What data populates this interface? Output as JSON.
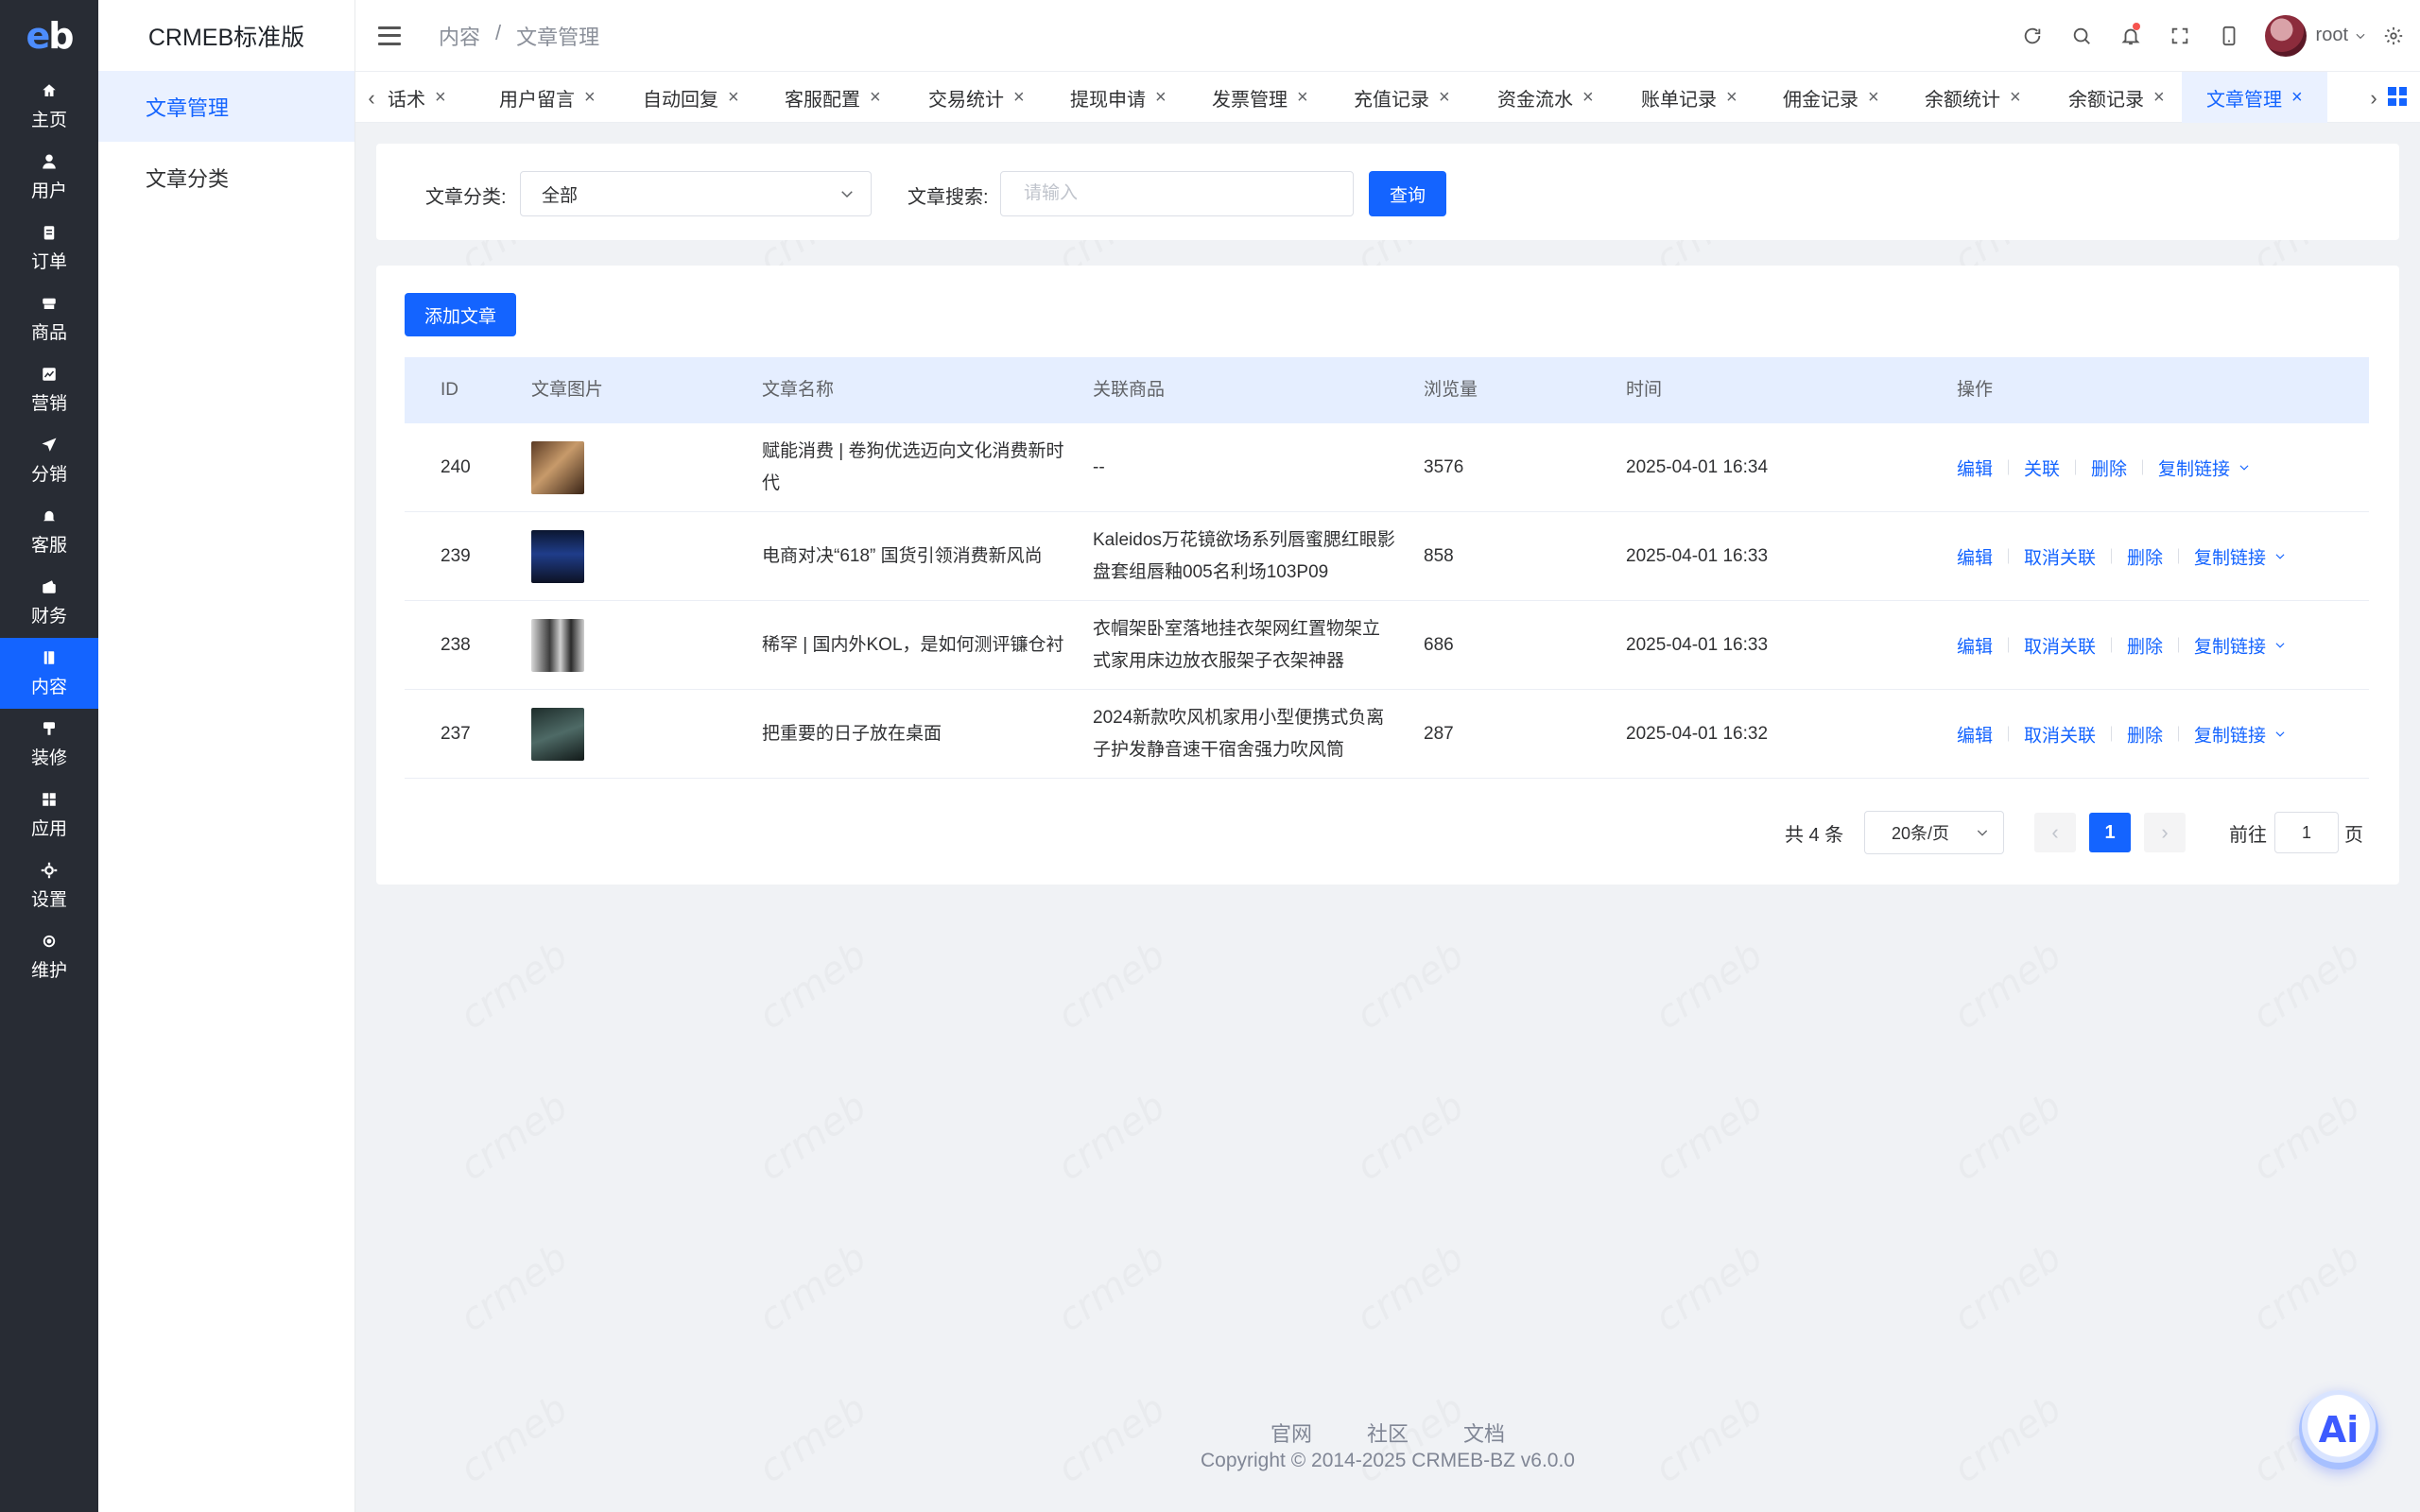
{
  "brand": {
    "logo_text": "eb",
    "title": "CRMEB标准版"
  },
  "rail": [
    {
      "label": "主页",
      "icon": "home-icon"
    },
    {
      "label": "用户",
      "icon": "user-icon"
    },
    {
      "label": "订单",
      "icon": "clipboard-icon"
    },
    {
      "label": "商品",
      "icon": "goods-icon"
    },
    {
      "label": "营销",
      "icon": "chart-icon"
    },
    {
      "label": "分销",
      "icon": "send-icon"
    },
    {
      "label": "客服",
      "icon": "bell-icon"
    },
    {
      "label": "财务",
      "icon": "wallet-icon"
    },
    {
      "label": "内容",
      "icon": "book-icon"
    },
    {
      "label": "装修",
      "icon": "brush-icon"
    },
    {
      "label": "应用",
      "icon": "apps-icon"
    },
    {
      "label": "设置",
      "icon": "gear-icon"
    },
    {
      "label": "维护",
      "icon": "chip-icon"
    }
  ],
  "rail_active": "内容",
  "submenu": [
    {
      "label": "文章管理"
    },
    {
      "label": "文章分类"
    }
  ],
  "breadcrumb": {
    "parent": "内容",
    "sep": "/",
    "current": "文章管理"
  },
  "user": {
    "name": "root"
  },
  "tabs": [
    {
      "label": "话术"
    },
    {
      "label": "用户留言"
    },
    {
      "label": "自动回复"
    },
    {
      "label": "客服配置"
    },
    {
      "label": "交易统计"
    },
    {
      "label": "提现申请"
    },
    {
      "label": "发票管理"
    },
    {
      "label": "充值记录"
    },
    {
      "label": "资金流水"
    },
    {
      "label": "账单记录"
    },
    {
      "label": "佣金记录"
    },
    {
      "label": "余额统计"
    },
    {
      "label": "余额记录"
    },
    {
      "label": "文章管理"
    }
  ],
  "filter": {
    "category_label": "文章分类:",
    "category_value": "全部",
    "search_label": "文章搜索:",
    "search_placeholder": "请输入",
    "query_button": "查询"
  },
  "add_button": "添加文章",
  "table": {
    "columns": [
      "ID",
      "文章图片",
      "文章名称",
      "关联商品",
      "浏览量",
      "时间",
      "操作"
    ],
    "rows": [
      {
        "id": "240",
        "image": "article-thumb-240",
        "title": "赋能消费 | 卷狗优选迈向文化消费新时代",
        "product": "--",
        "views": "3576",
        "time": "2025-04-01 16:34",
        "ops": [
          "编辑",
          "关联",
          "删除",
          "复制链接"
        ]
      },
      {
        "id": "239",
        "image": "article-thumb-239",
        "title": "电商对决“618” 国货引领消费新风尚",
        "product": "Kaleidos万花镜欲场系列唇蜜腮红眼影盘套组唇釉005名利场103P09",
        "views": "858",
        "time": "2025-04-01 16:33",
        "ops": [
          "编辑",
          "取消关联",
          "删除",
          "复制链接"
        ]
      },
      {
        "id": "238",
        "image": "article-thumb-238",
        "title": "稀罕 | 国内外KOL，是如何测评镰仓衬",
        "product": "衣帽架卧室落地挂衣架网红置物架立式家用床边放衣服架子衣架神器",
        "views": "686",
        "time": "2025-04-01 16:33",
        "ops": [
          "编辑",
          "取消关联",
          "删除",
          "复制链接"
        ]
      },
      {
        "id": "237",
        "image": "article-thumb-237",
        "title": "把重要的日子放在桌面",
        "product": "2024新款吹风机家用小型便携式负离子护发静音速干宿舍强力吹风筒",
        "views": "287",
        "time": "2025-04-01 16:32",
        "ops": [
          "编辑",
          "取消关联",
          "删除",
          "复制链接"
        ]
      }
    ]
  },
  "pagination": {
    "total": "共 4 条",
    "page_size": "20条/页",
    "current": "1",
    "goto_label": "前往",
    "goto_value": "1",
    "page_suffix": "页"
  },
  "footer": {
    "links": [
      "官网",
      "社区",
      "文档"
    ],
    "copyright": "Copyright © 2014-2025 CRMEB-BZ v6.0.0"
  },
  "ai_button": "Ai",
  "colors": {
    "primary": "#1464ff",
    "rail_bg": "#282c34",
    "table_header": "#e5eeff"
  },
  "watermark_text": "crmeb"
}
